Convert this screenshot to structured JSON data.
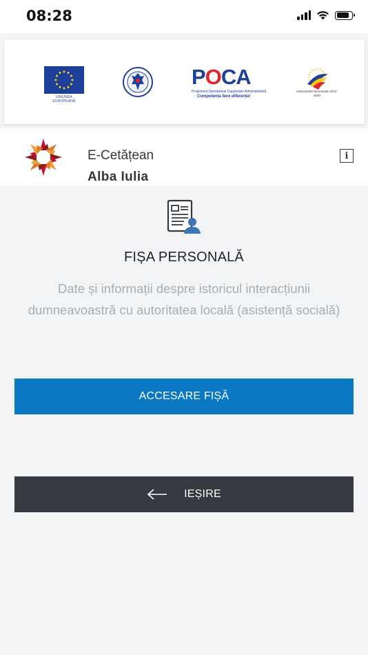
{
  "status_bar": {
    "time": "08:28",
    "icons": [
      "signal-icon",
      "wifi-icon",
      "battery-icon"
    ]
  },
  "sponsor_logos": {
    "eu_caption": "UNIUNEA EUROPEANĂ",
    "gov_seal": "guvernul-romaniei-seal",
    "poca": {
      "word_p": "P",
      "word_o": "O",
      "word_rest": "CA",
      "subtitle": "Programul Operațional Capacitate Administrativă",
      "tagline": "Competența face diferența!"
    },
    "ic_caption": "Instrumente Structurale 2014-2020"
  },
  "app_header": {
    "name": "E-Cetățean",
    "city": "Alba Iulia",
    "info_label": "i"
  },
  "main": {
    "icon": "personal-file-icon",
    "title": "FIȘA PERSONALĂ",
    "description": "Date și informații despre istoricul interacțiunii dumneavoastră cu autoritatea locală (asistență socială)",
    "primary_button": "ACCESARE FIȘĂ",
    "exit_button": "IEȘIRE"
  },
  "colors": {
    "primary": "#0a78c2",
    "dark_button": "#343a40",
    "background": "#f3f4f6",
    "muted_text": "#a6aeb3"
  }
}
